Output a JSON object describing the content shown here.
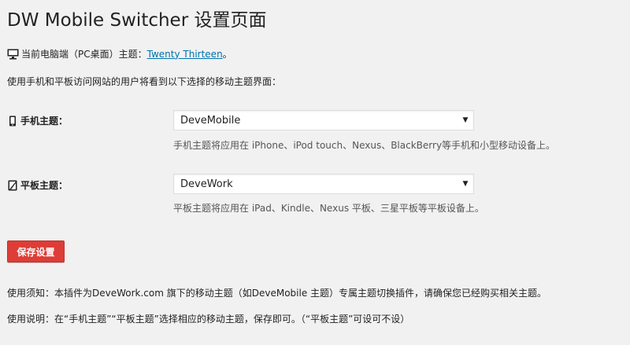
{
  "title": "DW Mobile Switcher 设置页面",
  "current_theme": {
    "label": "当前电脑端（PC桌面）主题：",
    "link": "Twenty Thirteen",
    "suffix": "。"
  },
  "intro": "使用手机和平板访问网站的用户将看到以下选择的移动主题界面：",
  "mobile": {
    "label": "手机主题：",
    "selected": "DeveMobile",
    "desc": "手机主题将应用在 iPhone、iPod touch、Nexus、BlackBerry等手机和小型移动设备上。"
  },
  "tablet": {
    "label": "平板主题：",
    "selected": "DeveWork",
    "desc": "平板主题将应用在 iPad、Kindle、Nexus 平板、三星平板等平板设备上。"
  },
  "save_label": "保存设置",
  "notice": "使用须知：本插件为DeveWork.com 旗下的移动主题（如DeveMobile 主题）专属主题切换插件，请确保您已经购买相关主题。",
  "usage": "使用说明：在“手机主题”“平板主题”选择相应的移动主题，保存即可。（“平板主题”可设可不设）",
  "icons": {
    "desktop": "desktop-icon",
    "mobile": "smartphone-icon",
    "tablet": "tablet-icon",
    "dropdown": "triangle-down-icon"
  },
  "colors": {
    "background": "#f1f1f1",
    "link": "#0073aa",
    "button": "#dd3d36"
  }
}
